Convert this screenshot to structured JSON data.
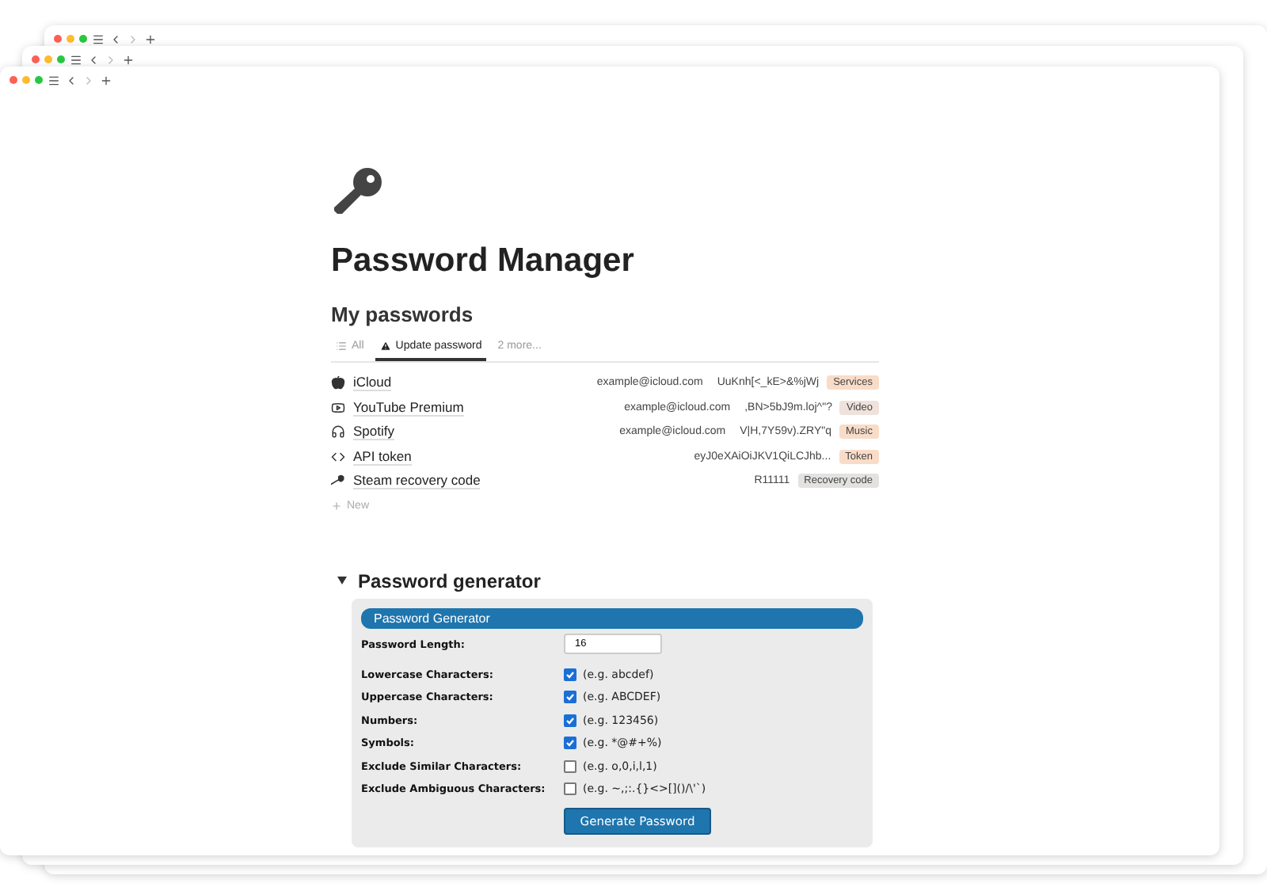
{
  "page": {
    "title": "Password Manager"
  },
  "passwords": {
    "heading": "My passwords",
    "tabs": [
      {
        "label": "All",
        "kind": "list",
        "selected": false
      },
      {
        "label": "Update password",
        "kind": "warning",
        "selected": true
      },
      {
        "label": "2 more...",
        "kind": "plain",
        "selected": false
      }
    ],
    "rows": [
      {
        "kind": "apple",
        "name": "iCloud",
        "email": "example@icloud.com",
        "password": "UuKnh[<_kE>&%jWj",
        "tag": "Services",
        "color": "#f9dcc8"
      },
      {
        "kind": "video",
        "name": "YouTube Premium",
        "email": "example@icloud.com",
        "password": ",BN>5bJ9m.loj^\"?",
        "tag": "Video",
        "color": "#efe2dc"
      },
      {
        "kind": "audio",
        "name": "Spotify",
        "email": "example@icloud.com",
        "password": "V|H,7Y59v).ZRY\"q",
        "tag": "Music",
        "color": "#f9dcc8"
      },
      {
        "kind": "code",
        "name": "API token",
        "email": "",
        "password": "eyJ0eXAiOiJKV1QiLCJhb...",
        "tag": "Token",
        "color": "#f9dcc8"
      },
      {
        "kind": "game",
        "name": "Steam recovery code",
        "email": "",
        "password": "R11111",
        "tag": "Recovery code",
        "color": "#e3e2e0"
      }
    ],
    "new_label": "New"
  },
  "generator": {
    "heading": "Password generator",
    "expanded": true,
    "panel_title": "Password Generator",
    "length_label": "Password Length:",
    "length_value": "16",
    "options": [
      {
        "label": "Lowercase Characters:",
        "example": "(e.g. abcdef)",
        "checked": true
      },
      {
        "label": "Uppercase Characters:",
        "example": "(e.g. ABCDEF)",
        "checked": true
      },
      {
        "label": "Numbers:",
        "example": "(e.g. 123456)",
        "checked": true
      },
      {
        "label": "Symbols:",
        "example": "(e.g. *@#+%)",
        "checked": true
      },
      {
        "label": "Exclude Similar Characters:",
        "example": "(e.g. o,0,i,l,1)",
        "checked": false
      },
      {
        "label": "Exclude Ambiguous Characters:",
        "example": "(e.g. ~,;:.{}<>[]()/\\'`)",
        "checked": false
      }
    ],
    "button": "Generate Password"
  }
}
